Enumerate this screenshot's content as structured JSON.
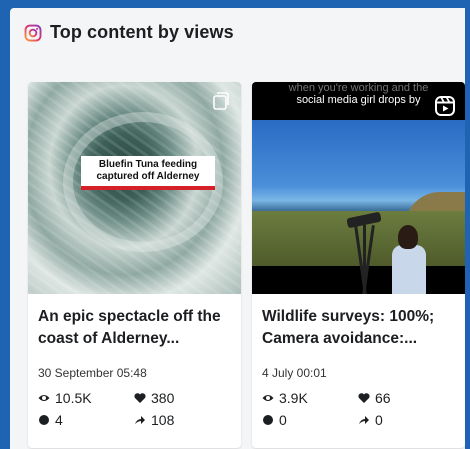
{
  "header": {
    "title": "Top content by views",
    "icon": "instagram-icon"
  },
  "cards": [
    {
      "thumbnail_caption": "Bluefin Tuna feeding captured off Alderney",
      "title": "An epic spectacle off the coast of Alderney...",
      "date": "30 September 05:48",
      "stats": {
        "views": "10.5K",
        "likes": "380",
        "comments": "4",
        "shares": "108"
      },
      "media_icon": "carousel-icon"
    },
    {
      "thumbnail_top_text_faded": "when you're working and the",
      "thumbnail_top_text": "social media girl drops by",
      "title": "Wildlife surveys: 100%; Camera avoidance:...",
      "date": "4 July 00:01",
      "stats": {
        "views": "3.9K",
        "likes": "66",
        "comments": "0",
        "shares": "0"
      },
      "media_icon": "reels-icon"
    }
  ],
  "colors": {
    "background": "#1f64b3",
    "panel": "#f4f5f7",
    "caption_accent": "#d62027"
  }
}
